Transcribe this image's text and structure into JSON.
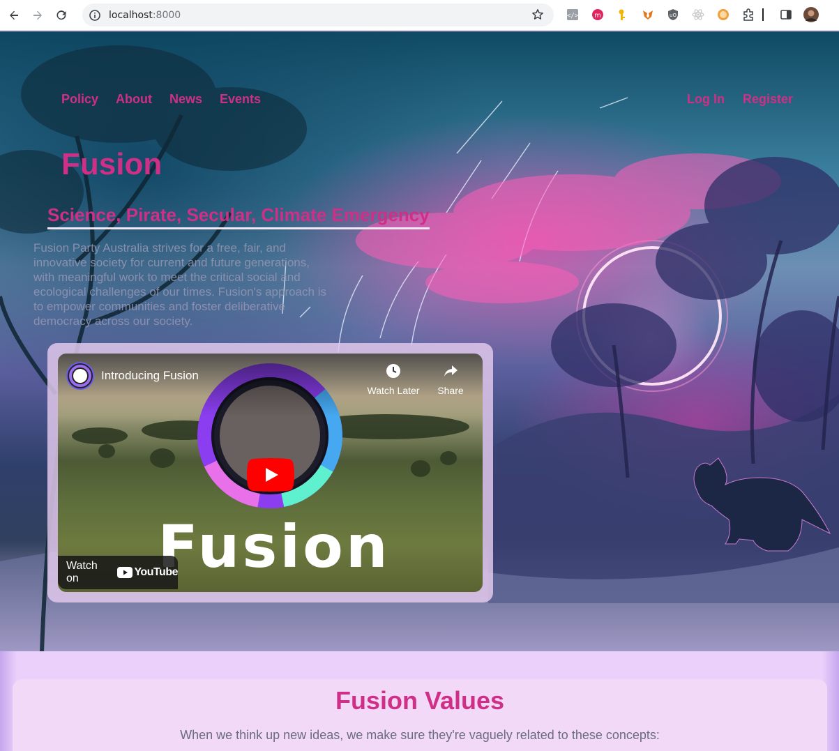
{
  "browser": {
    "url_host": "localhost",
    "url_port": ":8000",
    "extensions": [
      "dev-tools-icon",
      "mastodon-icon",
      "key-icon",
      "metamask-icon",
      "ublock-icon",
      "react-icon",
      "honey-icon",
      "puzzle-icon"
    ]
  },
  "nav": {
    "left": [
      "Policy",
      "About",
      "News",
      "Events"
    ],
    "right": [
      "Log In",
      "Register"
    ]
  },
  "hero": {
    "title": "Fusion",
    "tagline": "Science, Pirate, Secular, Climate Emergency",
    "intro": "Fusion Party Australia strives for a free, fair, and innovative society for current and future generations, with meaningful work to meet the critical social and ecological challenges of our times. Fusion's approach is to empower communities and foster deliberative democracy across our society."
  },
  "video": {
    "title": "Introducing Fusion",
    "watch_later": "Watch Later",
    "share": "Share",
    "watch_on": "Watch on",
    "youtube": "YouTube",
    "brand_word": "Fusion"
  },
  "values": {
    "title": "Fusion Values",
    "subtitle": "When we think up new ideas, we make sure they're vaguely related to these concepts:"
  },
  "colors": {
    "accent": "#cf2f86",
    "values_bg": "#ead0fa",
    "card_bg": "#f2d9f8"
  }
}
